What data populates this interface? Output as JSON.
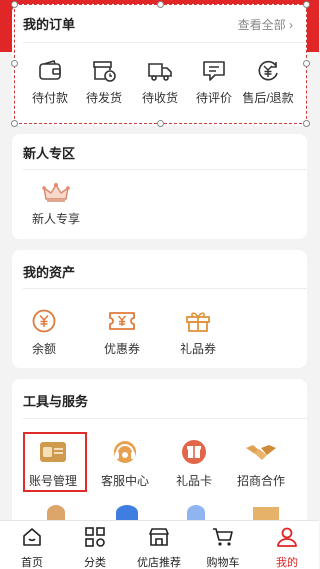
{
  "orders": {
    "title": "我的订单",
    "view_all": "查看全部 ›",
    "items": [
      {
        "label": "待付款",
        "icon": "wallet-icon"
      },
      {
        "label": "待发货",
        "icon": "package-clock-icon"
      },
      {
        "label": "待收货",
        "icon": "delivery-truck-icon"
      },
      {
        "label": "待评价",
        "icon": "comment-icon"
      },
      {
        "label": "售后/退款",
        "icon": "refund-icon"
      }
    ]
  },
  "newcomer": {
    "title": "新人专区",
    "items": [
      {
        "label": "新人专享",
        "icon": "crown-icon"
      }
    ]
  },
  "assets": {
    "title": "我的资产",
    "items": [
      {
        "label": "余额",
        "icon": "yen-coin-icon"
      },
      {
        "label": "优惠券",
        "icon": "coupon-icon"
      },
      {
        "label": "礼品券",
        "icon": "gift-icon"
      }
    ]
  },
  "tools": {
    "title": "工具与服务",
    "items": [
      {
        "label": "账号管理",
        "icon": "id-card-icon"
      },
      {
        "label": "客服中心",
        "icon": "headset-icon"
      },
      {
        "label": "礼品卡",
        "icon": "gift-card-icon"
      },
      {
        "label": "招商合作",
        "icon": "handshake-icon"
      }
    ]
  },
  "tabbar": {
    "items": [
      {
        "label": "首页",
        "icon": "home-icon"
      },
      {
        "label": "分类",
        "icon": "category-grid-icon"
      },
      {
        "label": "优店推荐",
        "icon": "store-icon"
      },
      {
        "label": "购物车",
        "icon": "cart-icon"
      },
      {
        "label": "我的",
        "icon": "person-icon"
      }
    ],
    "active_index": 4
  },
  "colors": {
    "accent": "#e02626",
    "assets_icon": "#e07a3a",
    "tools_icon": "#c88a3a"
  }
}
